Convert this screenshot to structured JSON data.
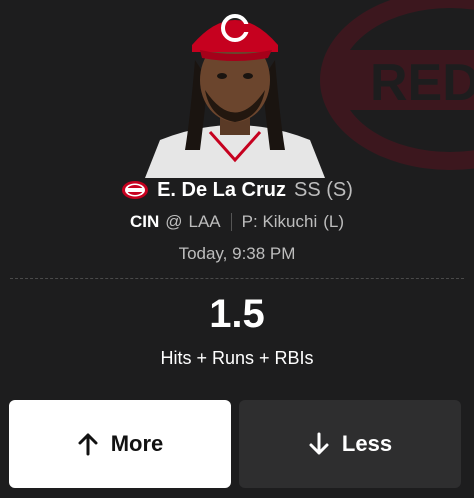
{
  "player": {
    "name": "E. De La Cruz",
    "position": "SS (S)",
    "team_logo_icon": "reds-logo-icon",
    "headshot_icon": "player-headshot"
  },
  "matchup": {
    "team": "CIN",
    "at": "@",
    "opponent": "LAA",
    "pitcher": "P: Kikuchi",
    "pitcher_hand": "(L)"
  },
  "game_time": "Today, 9:38 PM",
  "projection": {
    "line": "1.5",
    "stat_type": "Hits + Runs + RBIs"
  },
  "actions": {
    "more_label": "More",
    "less_label": "Less",
    "more_icon": "arrow-up-icon",
    "less_icon": "arrow-down-icon"
  },
  "colors": {
    "background": "#1d1d1e",
    "team_red": "#c6011f",
    "more_button": "#ffffff",
    "less_button": "#2e2e2f"
  }
}
